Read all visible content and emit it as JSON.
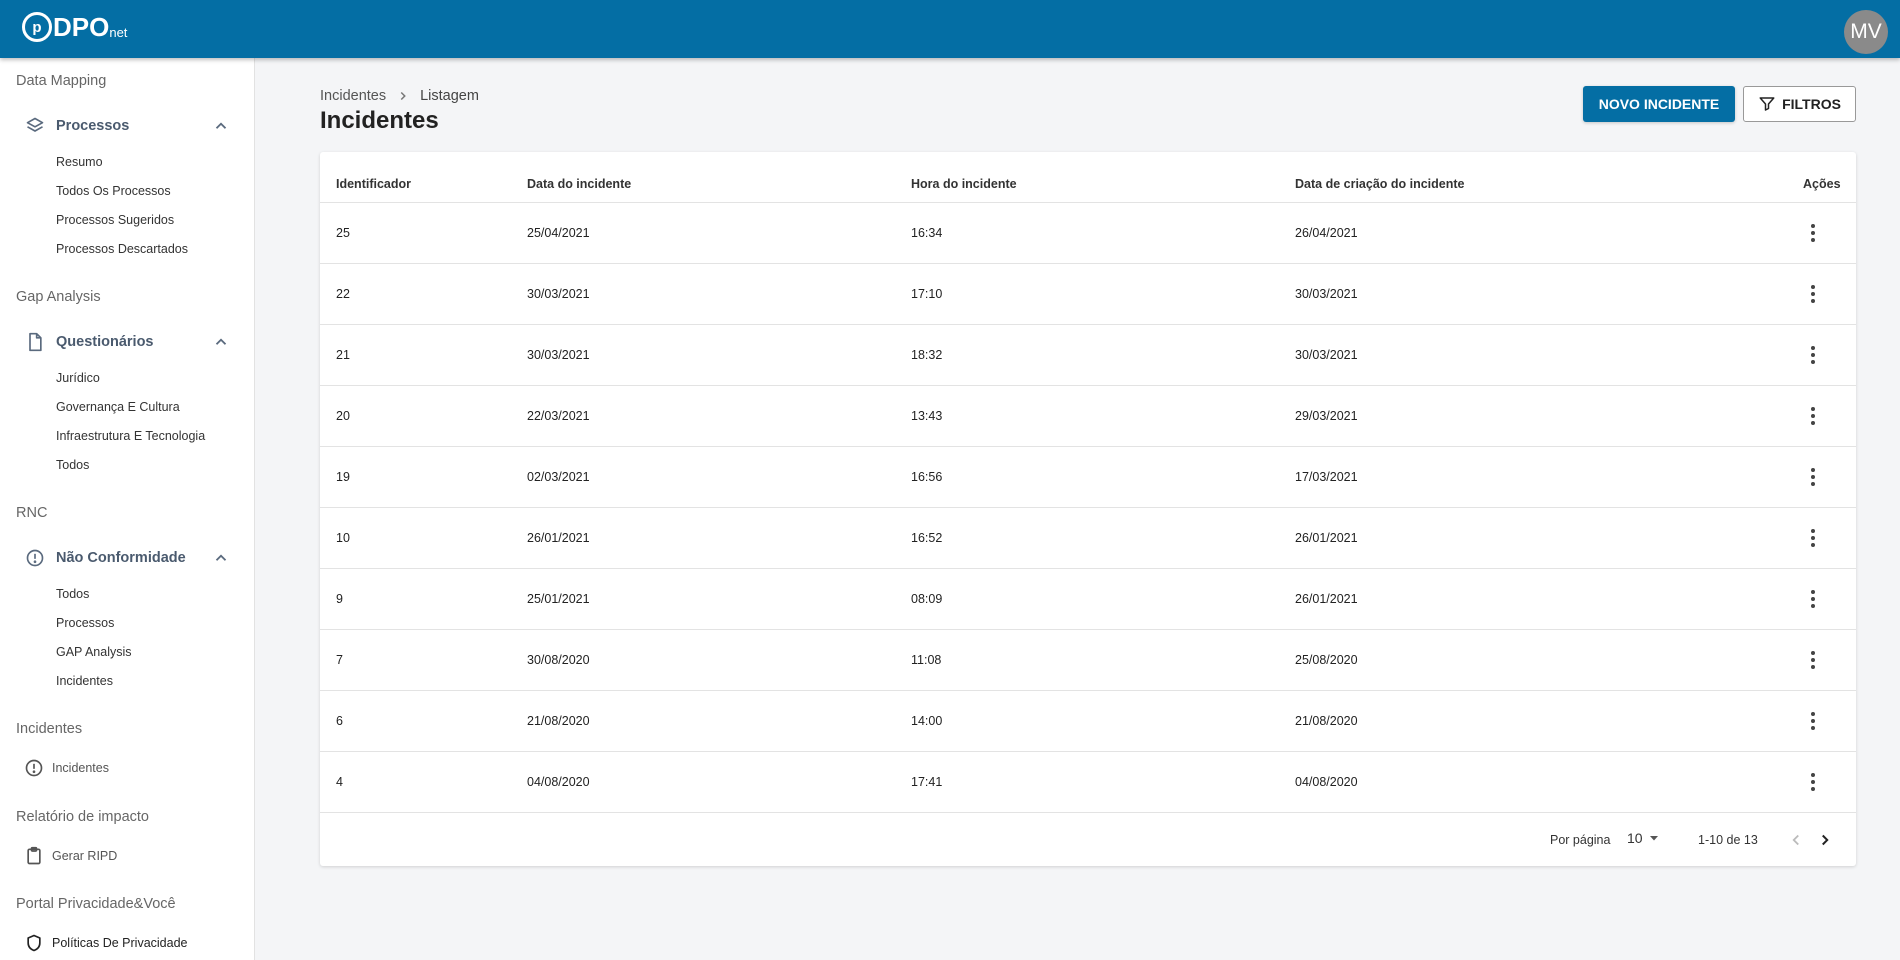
{
  "app": {
    "logo_letter": "p",
    "logo_text": "DPO",
    "logo_sub": "net",
    "user_initials": "MV"
  },
  "sidebar": {
    "sections": [
      {
        "title": "Data Mapping"
      },
      {
        "title": "Gap Analysis"
      },
      {
        "title": "RNC"
      },
      {
        "title": "Incidentes"
      },
      {
        "title": "Relatório de impacto"
      },
      {
        "title": "Portal Privacidade&Você"
      }
    ],
    "groups": [
      {
        "label": "Processos",
        "icon": "layers-icon",
        "items": [
          "Resumo",
          "Todos Os Processos",
          "Processos Sugeridos",
          "Processos Descartados"
        ]
      },
      {
        "label": "Questionários",
        "icon": "document-icon",
        "items": [
          "Jurídico",
          "Governança E Cultura",
          "Infraestrutura E Tecnologia",
          "Todos"
        ]
      },
      {
        "label": "Não Conformidade",
        "icon": "alert-circle-icon",
        "items": [
          "Todos",
          "Processos",
          "GAP Analysis",
          "Incidentes"
        ]
      }
    ],
    "singles": [
      {
        "label": "Incidentes",
        "icon": "alert-circle-icon"
      },
      {
        "label": "Gerar RIPD",
        "icon": "clipboard-icon"
      },
      {
        "label": "Políticas De Privacidade",
        "icon": "shield-icon"
      }
    ]
  },
  "breadcrumb": {
    "parent": "Incidentes",
    "current": "Listagem"
  },
  "page_title": "Incidentes",
  "actions": {
    "new_label": "NOVO INCIDENTE",
    "filter_label": "FILTROS"
  },
  "table": {
    "columns": [
      "Identificador",
      "Data do incidente",
      "Hora do incidente",
      "Data de criação do incidente",
      "Ações"
    ],
    "rows": [
      [
        "25",
        "25/04/2021",
        "16:34",
        "26/04/2021"
      ],
      [
        "22",
        "30/03/2021",
        "17:10",
        "30/03/2021"
      ],
      [
        "21",
        "30/03/2021",
        "18:32",
        "30/03/2021"
      ],
      [
        "20",
        "22/03/2021",
        "13:43",
        "29/03/2021"
      ],
      [
        "19",
        "02/03/2021",
        "16:56",
        "17/03/2021"
      ],
      [
        "10",
        "26/01/2021",
        "16:52",
        "26/01/2021"
      ],
      [
        "9",
        "25/01/2021",
        "08:09",
        "26/01/2021"
      ],
      [
        "7",
        "30/08/2020",
        "11:08",
        "25/08/2020"
      ],
      [
        "6",
        "21/08/2020",
        "14:00",
        "21/08/2020"
      ],
      [
        "4",
        "04/08/2020",
        "17:41",
        "04/08/2020"
      ]
    ]
  },
  "pagination": {
    "per_page_label": "Por página",
    "per_page_value": "10",
    "range": "1-10 de 13"
  },
  "colors": {
    "brand": "#046ea4",
    "background": "#f4f5f7"
  }
}
